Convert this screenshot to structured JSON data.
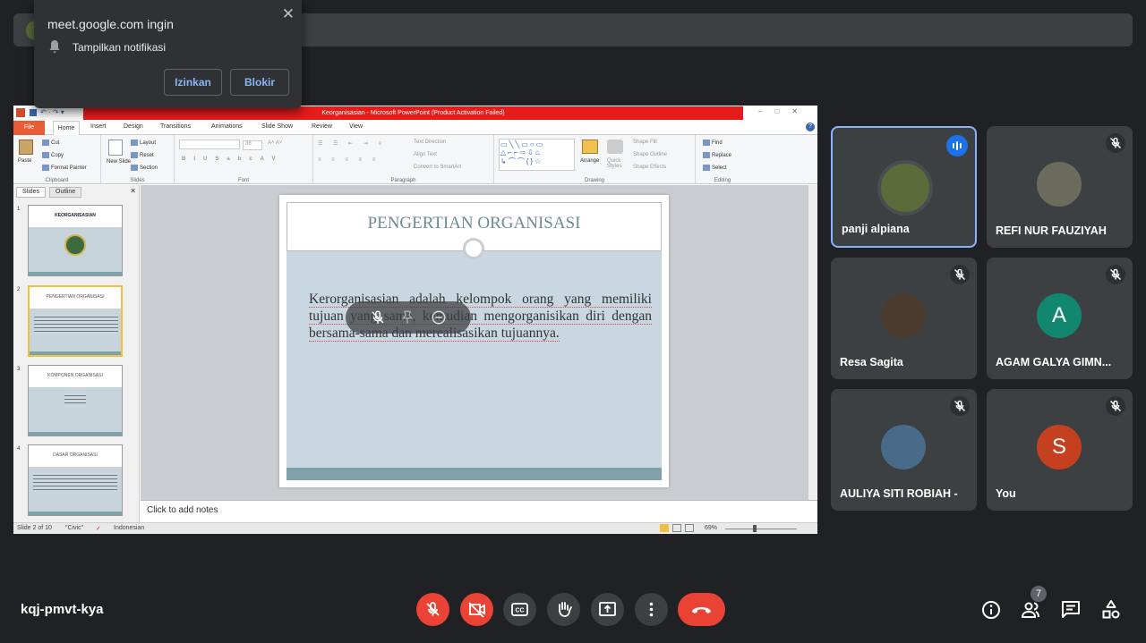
{
  "notification": {
    "title": "meet.google.com ingin",
    "message": "Tampilkan notifikasi",
    "allow_label": "Izinkan",
    "block_label": "Blokir"
  },
  "ppt": {
    "window_title": "Keorganisasian - Microsoft PowerPoint (Product Activation Failed)",
    "tabs": [
      "File",
      "Home",
      "Insert",
      "Design",
      "Transitions",
      "Animations",
      "Slide Show",
      "Review",
      "View"
    ],
    "ribbon": {
      "clipboard": {
        "label": "Clipboard",
        "paste": "Paste",
        "cut": "Cut",
        "copy": "Copy",
        "format_painter": "Format Painter"
      },
      "slides": {
        "label": "Slides",
        "new_slide": "New Slide",
        "layout": "Layout",
        "reset": "Reset",
        "section": "Section"
      },
      "font": {
        "label": "Font",
        "size": "36"
      },
      "paragraph": {
        "label": "Paragraph",
        "text_direction": "Text Direction",
        "align_text": "Align Text",
        "smartart": "Convert to SmartArt"
      },
      "drawing": {
        "label": "Drawing",
        "arrange": "Arrange",
        "quick_styles": "Quick Styles",
        "shape_fill": "Shape Fill",
        "shape_outline": "Shape Outline",
        "shape_effects": "Shape Effects"
      },
      "editing": {
        "label": "Editing",
        "find": "Find",
        "replace": "Replace",
        "select": "Select"
      }
    },
    "pane_tabs": [
      "Slides",
      "Outline"
    ],
    "thumbnails": [
      {
        "num": "1",
        "title": "KEORGANISASIAN"
      },
      {
        "num": "2",
        "title": "PENGERTIAN ORGANISASI"
      },
      {
        "num": "3",
        "title": "KOMPONEN ORGANISASI"
      },
      {
        "num": "4",
        "title": "DASAR ORGANISASI"
      }
    ],
    "slide": {
      "title": "PENGERTIAN ORGANISASI",
      "body": "Kerorganisasian adalah kelompok orang yang memiliki tujuan yang sama, kemudian mengorganisikan diri dengan bersama-sama dan merealisasikan tujuannya."
    },
    "notes_placeholder": "Click to add notes",
    "status": {
      "slide": "Slide 2 of 10",
      "theme": "\"Civic\"",
      "language": "Indonesian",
      "zoom": "69%"
    }
  },
  "participants": [
    {
      "name": "panji alpiana",
      "speaking": true,
      "muted": false,
      "color": "#3c4043"
    },
    {
      "name": "REFI NUR FAUZIYAH",
      "muted": true,
      "color": "#6d6a5e"
    },
    {
      "name": "Resa Sagita",
      "muted": true,
      "color": "#4b3a2e"
    },
    {
      "name": "AGAM GALYA GIMN...",
      "muted": true,
      "letter": "A",
      "color": "#12876f"
    },
    {
      "name": "AULIYA SITI ROBIAH -",
      "muted": true,
      "color": "#4a6a8a"
    },
    {
      "name": "You",
      "muted": true,
      "letter": "S",
      "color": "#c5401f"
    }
  ],
  "meeting_code": "kqj-pmvt-kya",
  "participant_count": "7"
}
